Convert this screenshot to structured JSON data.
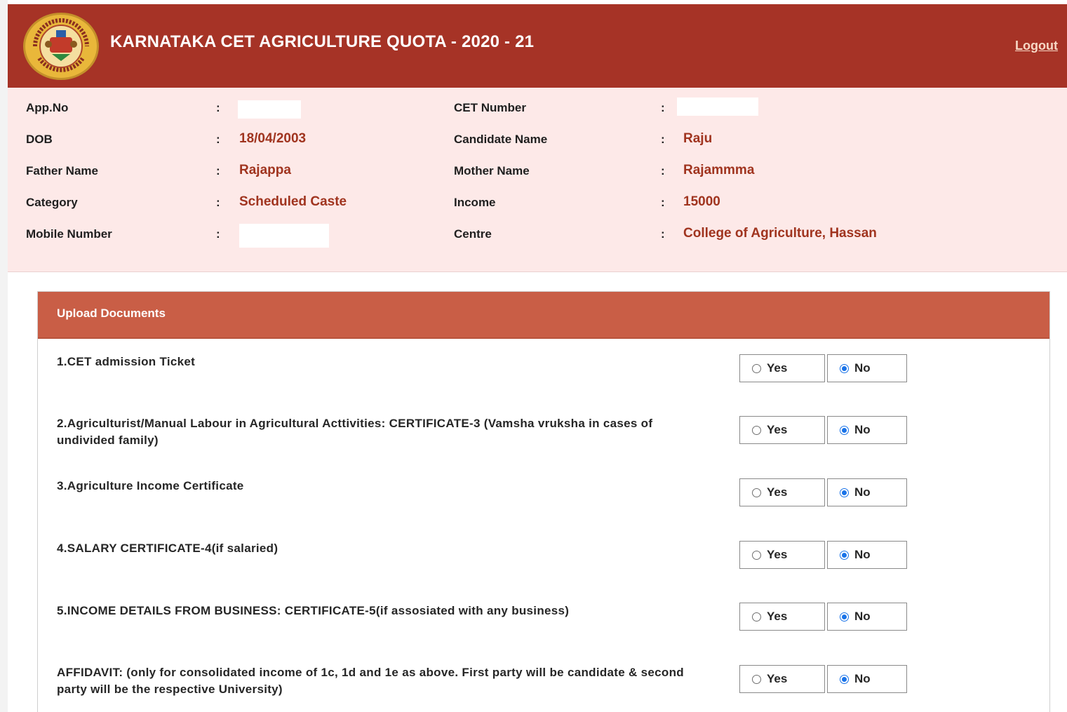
{
  "header": {
    "title": "KARNATAKA CET AGRICULTURE QUOTA - 2020 - 21",
    "logout_label": "Logout",
    "brand_color": "#a63326"
  },
  "info": {
    "separator": ":",
    "app_no": {
      "label": "App.No",
      "value": ""
    },
    "cet_number": {
      "label": "CET Number",
      "value": ""
    },
    "dob": {
      "label": "DOB",
      "value": "18/04/2003"
    },
    "candidate_name": {
      "label": "Candidate Name",
      "value": "Raju"
    },
    "father_name": {
      "label": "Father Name",
      "value": "Rajappa"
    },
    "mother_name": {
      "label": "Mother Name",
      "value": "Rajammma"
    },
    "category": {
      "label": "Category",
      "value": "Scheduled Caste"
    },
    "income": {
      "label": "Income",
      "value": "15000"
    },
    "mobile_number": {
      "label": "Mobile Number",
      "value": ""
    },
    "centre": {
      "label": "Centre",
      "value": "College of Agriculture, Hassan"
    }
  },
  "upload": {
    "title": "Upload Documents",
    "yes_label": "Yes",
    "no_label": "No",
    "documents": [
      {
        "label": "1.CET admission Ticket",
        "selected": "No"
      },
      {
        "label": "2.Agriculturist/Manual Labour in Agricultural Acttivities: CERTIFICATE-3 (Vamsha vruksha in cases of undivided family)",
        "selected": "No"
      },
      {
        "label": "3.Agriculture Income Certificate",
        "selected": "No"
      },
      {
        "label": "4.SALARY CERTIFICATE-4(if salaried)",
        "selected": "No"
      },
      {
        "label": "5.INCOME DETAILS FROM BUSINESS: CERTIFICATE-5(if assosiated with any business)",
        "selected": "No"
      },
      {
        "label": "AFFIDAVIT: (only for consolidated income of 1c, 1d and 1e as above. First party will be candidate & second party will be the respective University)",
        "selected": "No"
      }
    ]
  }
}
